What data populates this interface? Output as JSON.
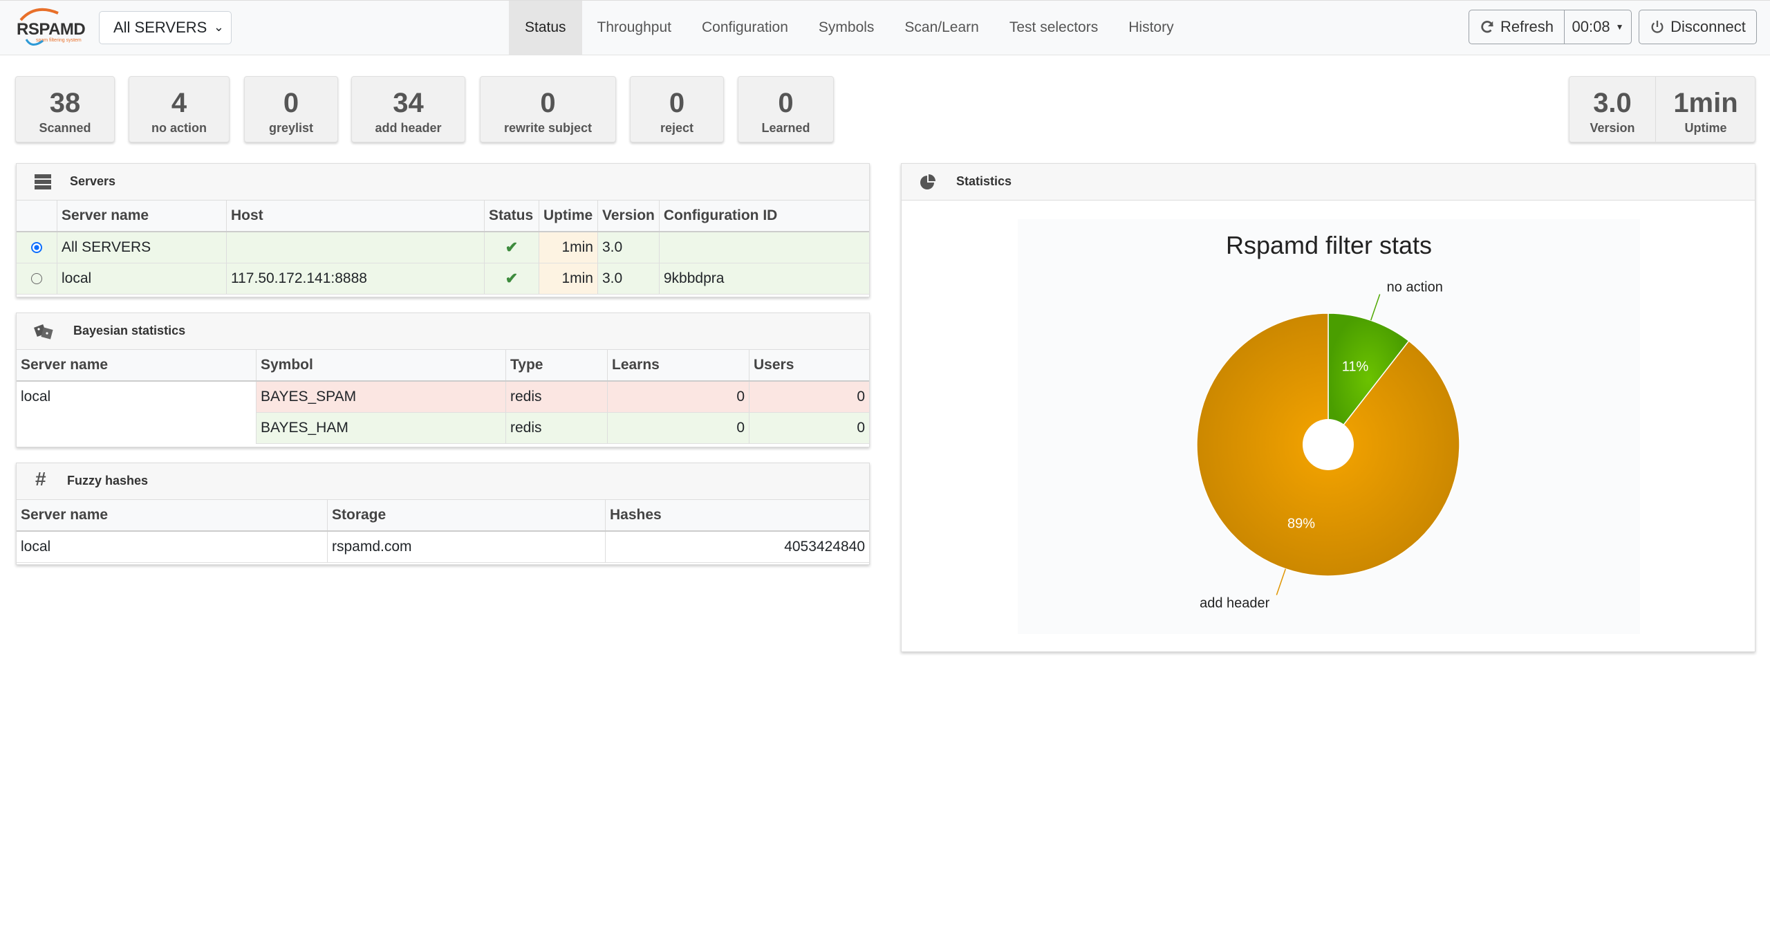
{
  "app": {
    "logo_text": "RSPAMD",
    "logo_sub": "spam filtering system"
  },
  "server_select": {
    "value": "All SERVERS"
  },
  "nav": {
    "tabs": [
      {
        "label": "Status",
        "active": true
      },
      {
        "label": "Throughput"
      },
      {
        "label": "Configuration"
      },
      {
        "label": "Symbols"
      },
      {
        "label": "Scan/Learn"
      },
      {
        "label": "Test selectors"
      },
      {
        "label": "History"
      }
    ],
    "refresh_label": "Refresh",
    "timer_label": "00:08",
    "disconnect_label": "Disconnect"
  },
  "stats": [
    {
      "value": "38",
      "label": "Scanned"
    },
    {
      "value": "4",
      "label": "no action"
    },
    {
      "value": "0",
      "label": "greylist"
    },
    {
      "value": "34",
      "label": "add header"
    },
    {
      "value": "0",
      "label": "rewrite subject"
    },
    {
      "value": "0",
      "label": "reject"
    },
    {
      "value": "0",
      "label": "Learned"
    }
  ],
  "info": {
    "version_value": "3.0",
    "version_label": "Version",
    "uptime_value": "1min",
    "uptime_label": "Uptime"
  },
  "servers_panel": {
    "title": "Servers",
    "headers": [
      "Server name",
      "Host",
      "Status",
      "Uptime",
      "Version",
      "Configuration ID"
    ],
    "rows": [
      {
        "name": "All SERVERS",
        "host": "",
        "uptime": "1min",
        "version": "3.0",
        "config_id": "",
        "selected": true
      },
      {
        "name": "local",
        "host": "117.50.172.141:8888",
        "uptime": "1min",
        "version": "3.0",
        "config_id": "9kbbdpra",
        "selected": false
      }
    ]
  },
  "bayes_panel": {
    "title": "Bayesian statistics",
    "headers": [
      "Server name",
      "Symbol",
      "Type",
      "Learns",
      "Users"
    ],
    "server": "local",
    "rows": [
      {
        "symbol": "BAYES_SPAM",
        "type": "redis",
        "learns": "0",
        "users": "0"
      },
      {
        "symbol": "BAYES_HAM",
        "type": "redis",
        "learns": "0",
        "users": "0"
      }
    ]
  },
  "fuzzy_panel": {
    "title": "Fuzzy hashes",
    "headers": [
      "Server name",
      "Storage",
      "Hashes"
    ],
    "rows": [
      {
        "name": "local",
        "storage": "rspamd.com",
        "hashes": "4053424840"
      }
    ]
  },
  "statistics_panel": {
    "title": "Statistics"
  },
  "chart_data": {
    "type": "pie",
    "title": "Rspamd filter stats",
    "slices": [
      {
        "label": "no action",
        "value": 4,
        "percent_label": "11%",
        "color": "#4fa800"
      },
      {
        "label": "add header",
        "value": 34,
        "percent_label": "89%",
        "color": "#e09500"
      }
    ]
  }
}
